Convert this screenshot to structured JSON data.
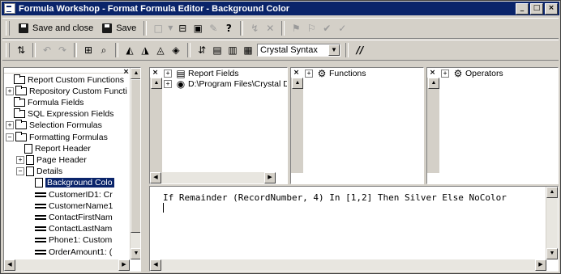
{
  "window": {
    "title": "Formula Workshop - Format Formula Editor - Background Color",
    "controls": {
      "minimize": "_",
      "maximize": "□",
      "close": "×"
    }
  },
  "toolbar1": {
    "save_and_close_label": "Save and close",
    "save_label": "Save",
    "icons": [
      "new-icon",
      "dropdown-arrow-icon",
      "browse-icon",
      "properties-icon",
      "edit-icon",
      "help-icon",
      "toggle-properties-icon",
      "delete-icon",
      "bookmark-icon",
      "next-bookmark-icon",
      "check-icon",
      "check-all-icon"
    ]
  },
  "toolbar2": {
    "syntax_value": "Crystal Syntax",
    "comment_label": "//"
  },
  "tree": {
    "items": [
      {
        "label": "Report Custom Functions",
        "expander": "",
        "indent": 0
      },
      {
        "label": "Repository Custom Functi",
        "expander": "+",
        "indent": 0
      },
      {
        "label": "Formula Fields",
        "expander": "",
        "indent": 0
      },
      {
        "label": "SQL Expression Fields",
        "expander": "",
        "indent": 0
      },
      {
        "label": "Selection Formulas",
        "expander": "+",
        "indent": 0
      },
      {
        "label": "Formatting Formulas",
        "expander": "−",
        "indent": 0
      },
      {
        "label": "Report Header",
        "expander": "",
        "indent": 1
      },
      {
        "label": "Page Header",
        "expander": "+",
        "indent": 1
      },
      {
        "label": "Details",
        "expander": "−",
        "indent": 1
      },
      {
        "label": "Background Colo",
        "expander": "",
        "indent": 2,
        "selected": true
      },
      {
        "label": "CustomerID1: Cr",
        "expander": "",
        "indent": 2
      },
      {
        "label": "CustomerName1",
        "expander": "",
        "indent": 2
      },
      {
        "label": "ContactFirstNam",
        "expander": "",
        "indent": 2
      },
      {
        "label": "ContactLastNam",
        "expander": "",
        "indent": 2
      },
      {
        "label": "Phone1: Custom",
        "expander": "",
        "indent": 2
      },
      {
        "label": "OrderAmount1: (",
        "expander": "",
        "indent": 2
      }
    ]
  },
  "fields_panel": {
    "items": [
      {
        "label": "Report Fields",
        "expander": "+"
      },
      {
        "label": "D:\\Program Files\\Crystal De",
        "expander": "+"
      }
    ]
  },
  "functions_panel": {
    "label": "Functions",
    "expander": "+"
  },
  "operators_panel": {
    "label": "Operators",
    "expander": "+"
  },
  "editor": {
    "code": "If Remainder (RecordNumber, 4) In [1,2] Then Silver Else NoColor"
  },
  "colors": {
    "title_bar": "#0a246a",
    "face": "#d4d0c8",
    "selection": "#0a246a"
  }
}
